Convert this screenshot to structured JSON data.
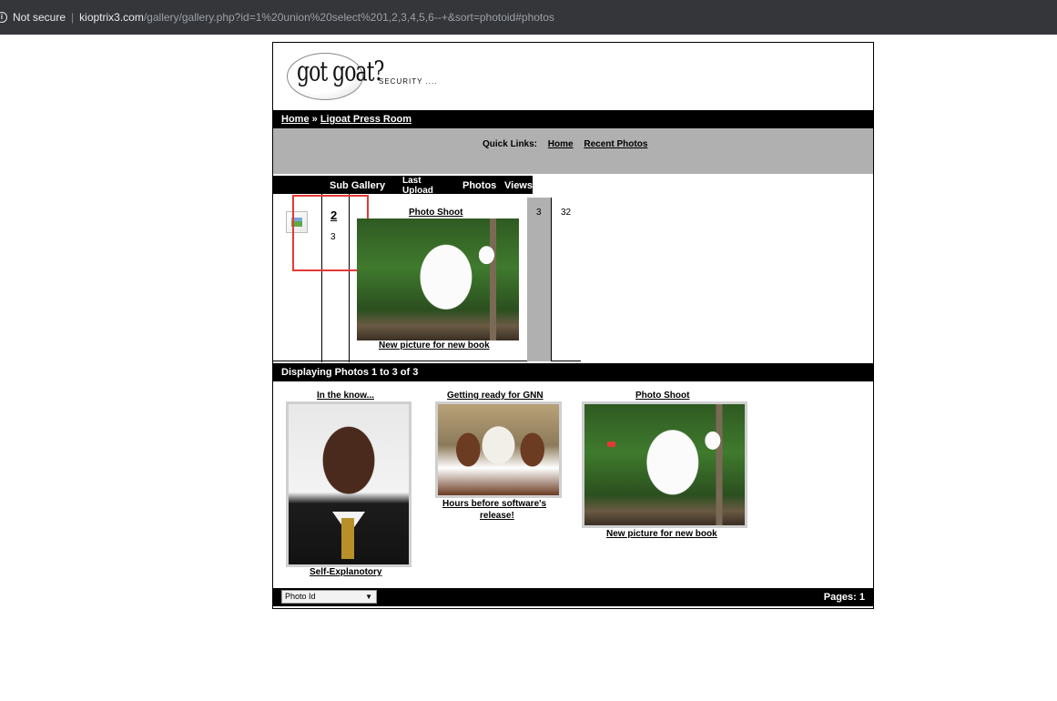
{
  "browser": {
    "security": "Not secure",
    "host": "kioptrix3.com",
    "path": "/gallery/gallery.php?id=1%20union%20select%201,2,3,4,5,6--+&sort=photoid#photos"
  },
  "site": {
    "logo": "got goat?",
    "tagline": "SECURITY ...."
  },
  "breadcrumb": {
    "home": "Home",
    "sep": "»",
    "current": "Ligoat Press Room"
  },
  "quick_links": {
    "label": "Quick Links:",
    "home": "Home",
    "recent": "Recent Photos"
  },
  "subgallery": {
    "headers": {
      "sub_gallery": "Sub Gallery",
      "last_upload_1": "Last",
      "last_upload_2": "Upload",
      "photos": "Photos",
      "views": "Views"
    },
    "row": {
      "id": "2",
      "count": "3",
      "title": "Photo Shoot",
      "caption": "New picture for new book",
      "photos": "3",
      "views": "32"
    }
  },
  "photos_section": {
    "title": "Displaying Photos 1 to 3 of 3",
    "items": [
      {
        "title": "In the know...",
        "caption": "Self-Explanotory"
      },
      {
        "title": "Getting ready for GNN",
        "caption_1": "Hours before software's",
        "caption_2": "release!"
      },
      {
        "title": "Photo Shoot",
        "caption": "New picture for new book"
      }
    ]
  },
  "footer": {
    "sort_select": "Photo Id",
    "pages": "Pages: 1"
  }
}
